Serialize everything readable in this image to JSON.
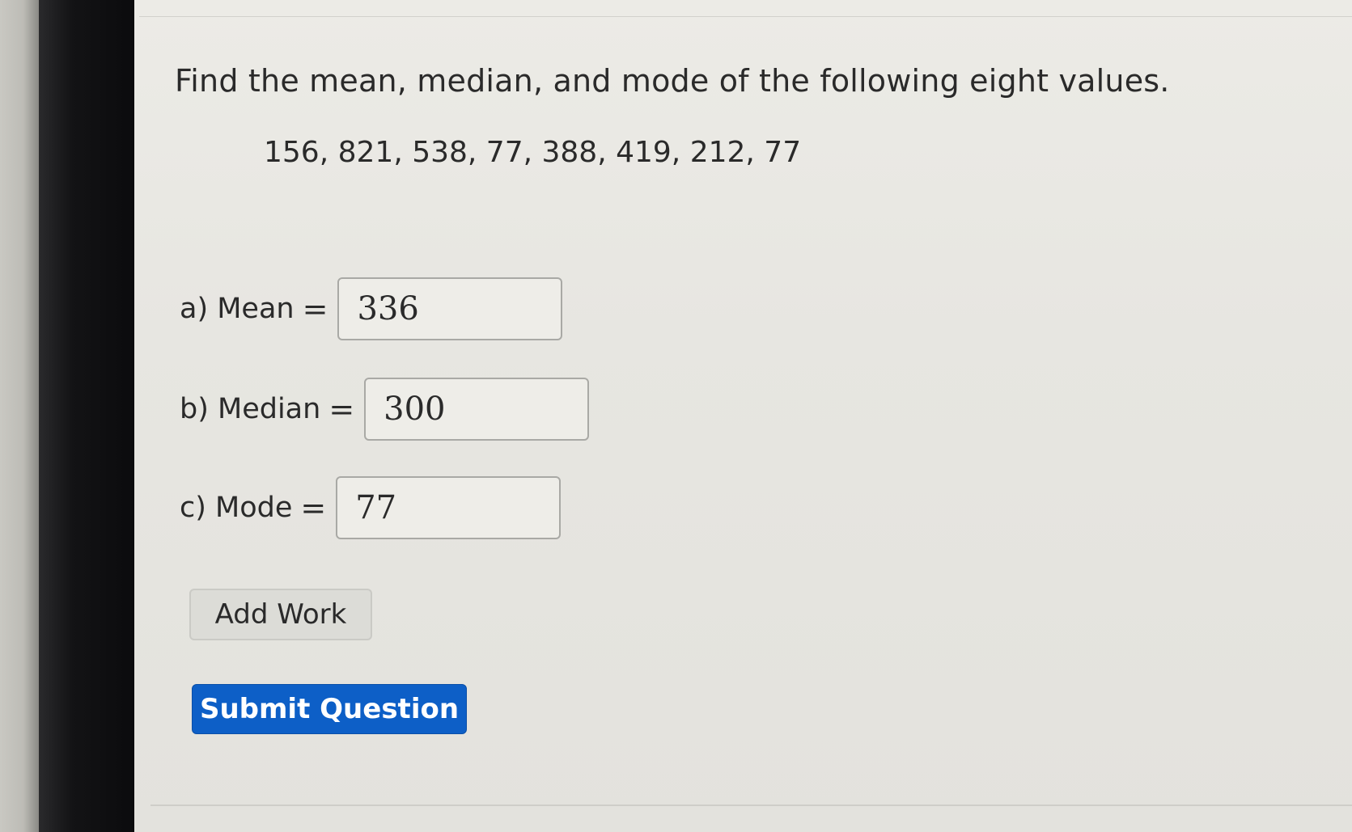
{
  "question": {
    "prompt": "Find the mean, median, and mode of the following eight values.",
    "values": "156, 821, 538, 77, 388, 419, 212, 77"
  },
  "answers": {
    "mean": {
      "label": "a) Mean",
      "equals": "=",
      "value": "336"
    },
    "median": {
      "label": "b) Median",
      "equals": "=",
      "value": "300"
    },
    "mode": {
      "label": "c) Mode",
      "equals": "=",
      "value": "77"
    }
  },
  "buttons": {
    "add_work": "Add Work",
    "submit": "Submit Question"
  },
  "colors": {
    "submit_bg": "#0d5fc7",
    "submit_text": "#ffffff",
    "text": "#2a2a2a"
  }
}
